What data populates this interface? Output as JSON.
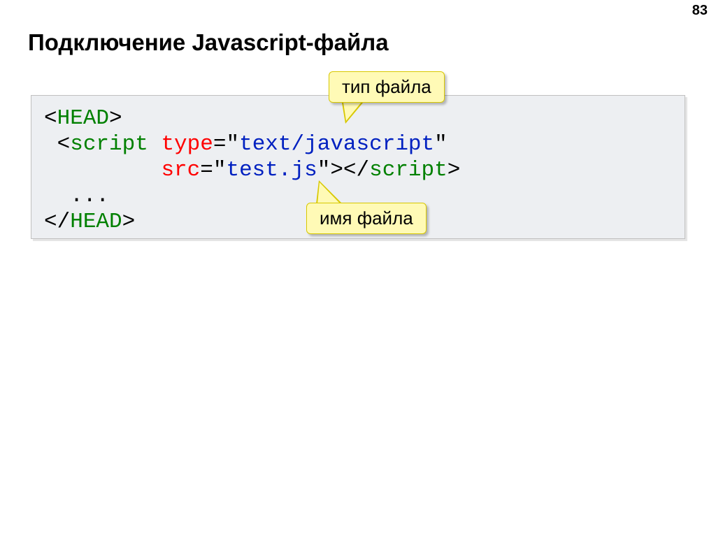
{
  "page_number": "83",
  "title": "Подключение Javascript-файла",
  "callouts": {
    "file_type": "тип файла",
    "file_name": "имя файла"
  },
  "code": {
    "head_open_lt": "<",
    "head_open_tag": "HEAD",
    "head_open_gt": ">",
    "indent2": " ",
    "script_open_lt": "<",
    "script_tag": "script",
    "space1": " ",
    "type_attr": "type",
    "eq1": "=\"",
    "type_val": "text/javascript",
    "q1": "\"",
    "indent_src": "         ",
    "src_attr": "src",
    "eq2": "=\"",
    "src_val": "test.js",
    "q2": "\"",
    "script_close_lt": "></",
    "script_close_tag": "script",
    "script_close_gt": ">",
    "dots_indent": "  ",
    "dots": "...",
    "head_close_lt": "</",
    "head_close_tag": "HEAD",
    "head_close_gt": ">"
  }
}
